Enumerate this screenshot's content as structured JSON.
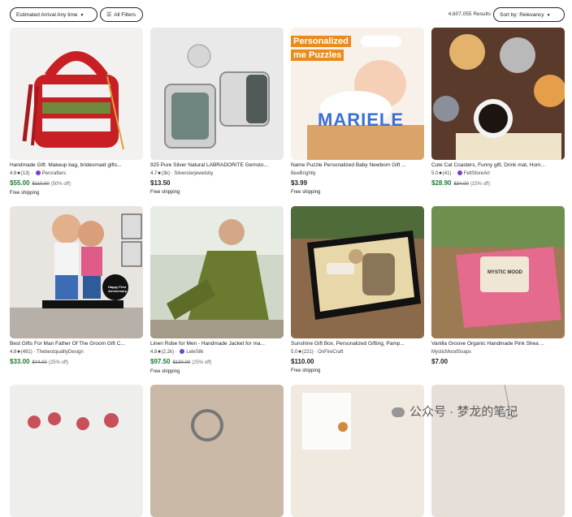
{
  "filters": {
    "estimated_arrival": "Estimated Arrival Any time",
    "all_filters": "All Filters",
    "filter_icon": "sliders-icon",
    "caret_icon": "chevron-down-icon"
  },
  "results": {
    "count": "4,607,055 Results"
  },
  "sort": {
    "label": "Sort by: Relevancy"
  },
  "colors": {
    "sale_green": "#1f7a33",
    "badge_purple": "#7a3fcf"
  },
  "listings": [
    {
      "title": "Handmade Gift: Makeup bag, bridesmaid gifts...",
      "rating": "4.8",
      "reviews": "(13)",
      "shop": "Percrafters",
      "star_seller": true,
      "price": "$55.00",
      "original_price": "$110.00",
      "discount": "(50% off)",
      "shipping": "Free shipping"
    },
    {
      "title": "925 Pure Silver Natural LABRADORITE Gemsto...",
      "rating": "4.7",
      "reviews": "(3k)",
      "shop": "Silversterjewelsby",
      "star_seller": false,
      "price": "$13.50",
      "original_price": "",
      "discount": "",
      "shipping": "Free shipping"
    },
    {
      "title": "Name Puzzle Personalized Baby Newborn Gift ...",
      "rating": "",
      "reviews": "",
      "shop": "BeeBrightly",
      "star_seller": false,
      "price": "$3.99",
      "original_price": "",
      "discount": "",
      "shipping": "Free shipping"
    },
    {
      "title": "Cute Cat Coasters, Funny gift, Drink mat, Hom...",
      "rating": "5.0",
      "reviews": "(41)",
      "shop": "FeltStoreArt",
      "star_seller": true,
      "price": "$28.90",
      "original_price": "$34.00",
      "discount": "(15% off)",
      "shipping": ""
    },
    {
      "title": "Best Gifts For Man Father Of The Groom Gift C...",
      "rating": "4.8",
      "reviews": "(481)",
      "shop": "ThebestqualityDesign",
      "star_seller": false,
      "price": "$33.00",
      "original_price": "$44.00",
      "discount": "(25% off)",
      "shipping": ""
    },
    {
      "title": "Linen Robe for Men - Handmade Jacket for ma...",
      "rating": "4.8",
      "reviews": "(2.2k)",
      "shop": "LeleSilk",
      "star_seller": true,
      "price": "$97.50",
      "original_price": "$130.00",
      "discount": "(25% off)",
      "shipping": "Free shipping"
    },
    {
      "title": "Sunshine Gift Box, Personalized Gifting, Pamp...",
      "rating": "5.0",
      "reviews": "(221)",
      "shop": "OnFireCraft",
      "star_seller": false,
      "price": "$110.00",
      "original_price": "",
      "discount": "",
      "shipping": "Free shipping"
    },
    {
      "title": "Vanilla Groove Organic Handmade Pink Shea ...",
      "rating": "",
      "reviews": "",
      "shop": "MysticMoodSoaps",
      "star_seller": false,
      "price": "$7.00",
      "original_price": "",
      "discount": "",
      "shipping": ""
    }
  ],
  "thumb_text": {
    "puzzle_line1": "Personalized",
    "puzzle_line2": "me Puzzles",
    "puzzle_letters": "MARIELE",
    "soap_stamp": "MYSTIC MOOD",
    "cake_text": "Happy First Anniversary"
  },
  "watermark": {
    "text": "公众号 · 梦龙的笔记",
    "icon": "wechat-icon"
  }
}
